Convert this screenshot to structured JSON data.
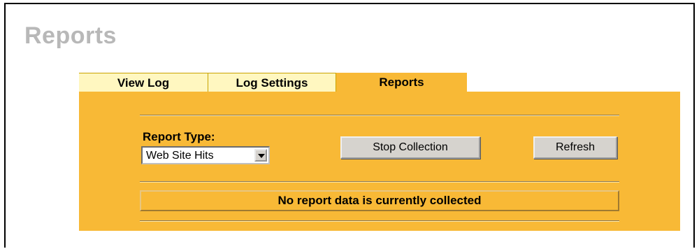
{
  "page": {
    "title": "Reports"
  },
  "tabs": [
    {
      "label": "View Log"
    },
    {
      "label": "Log Settings"
    },
    {
      "label": "Reports"
    }
  ],
  "report": {
    "type_label": "Report Type:",
    "selected_type": "Web Site Hits",
    "stop_button": "Stop Collection",
    "refresh_button": "Refresh",
    "status_message": "No report data is currently collected"
  },
  "colors": {
    "panel": "#f8b936",
    "inactive_tab": "#fff7c0",
    "title_gray": "#b8b8b8",
    "button": "#d6d3ce"
  }
}
